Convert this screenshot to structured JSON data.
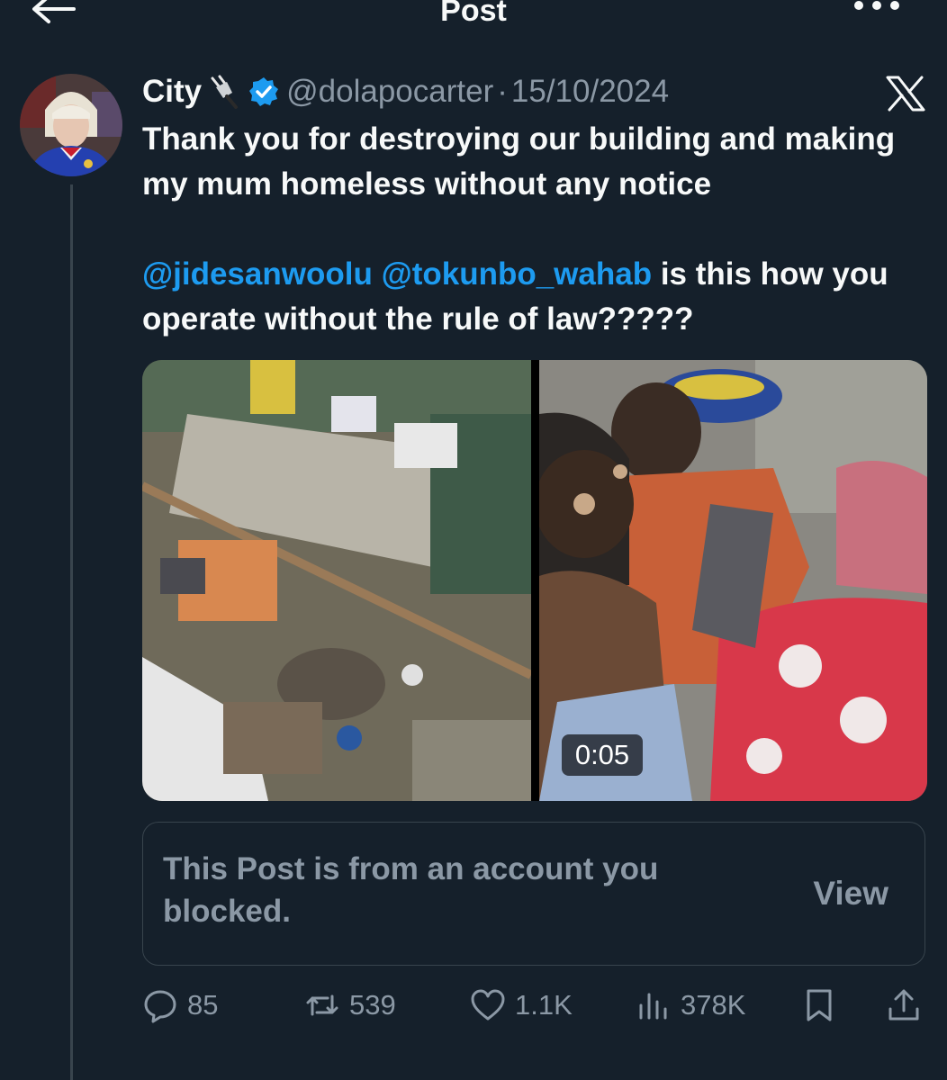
{
  "header": {
    "title": "Post"
  },
  "post": {
    "display_name": "City",
    "handle": "@dolapocarter",
    "separator": "·",
    "date": "15/10/2024",
    "text_line1": "Thank you for destroying our building and making my mum homeless without any notice",
    "mention1": "@jidesanwoolu",
    "mention2": "@tokunbo_wahab",
    "text_line2": " is this how you operate without the rule of law?????"
  },
  "media": {
    "duration": "0:05"
  },
  "blocked_card": {
    "message": "This Post is from an account you blocked.",
    "view_label": "View"
  },
  "actions": {
    "replies": "85",
    "reposts": "539",
    "likes": "1.1K",
    "views": "378K"
  },
  "colors": {
    "background": "#15202b",
    "accent": "#1d9bf0",
    "muted": "#8b98a5",
    "border": "#38444d"
  }
}
